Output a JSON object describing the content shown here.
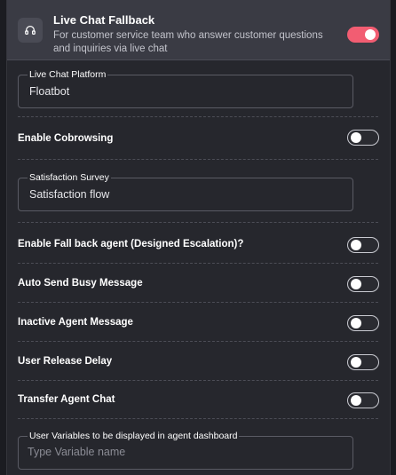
{
  "header": {
    "title": "Live Chat Fallback",
    "description": "For customer service team who answer customer questions and inquiries via live chat",
    "icon": "headset-icon",
    "enabled": true
  },
  "platform": {
    "label": "Live Chat Platform",
    "value": "Floatbot"
  },
  "settings": [
    {
      "label": "Enable Cobrowsing",
      "enabled": false
    },
    {
      "label": "Enable Fall back agent (Designed Escalation)?",
      "enabled": false
    },
    {
      "label": "Auto Send Busy Message",
      "enabled": false
    },
    {
      "label": "Inactive Agent Message",
      "enabled": false
    },
    {
      "label": "User Release Delay",
      "enabled": false
    },
    {
      "label": "Transfer Agent Chat",
      "enabled": false
    }
  ],
  "survey": {
    "label": "Satisfaction Survey",
    "value": "Satisfaction flow"
  },
  "user_variables": {
    "label": "User Variables to be displayed in agent dashboard",
    "placeholder": "Type Variable name"
  },
  "colors": {
    "accent": "#f25d72",
    "background": "#26272d",
    "header": "#3a3b44"
  }
}
